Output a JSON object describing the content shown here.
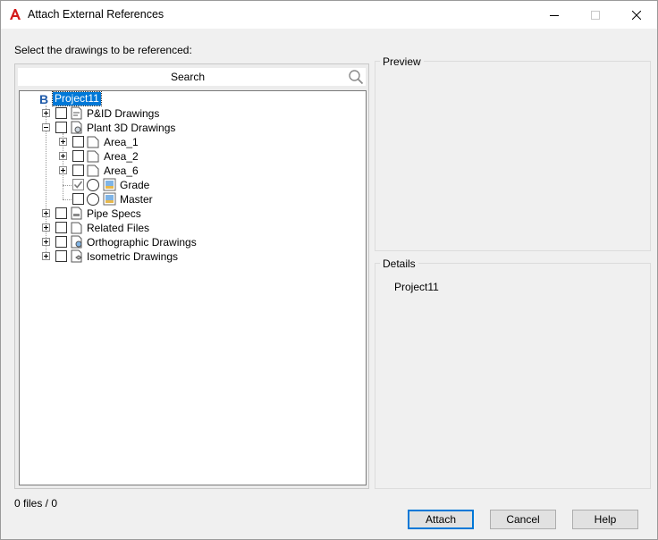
{
  "window": {
    "title": "Attach External References",
    "accent_color": "#0078d7",
    "app_icon": "autocad-a-icon"
  },
  "instruction": "Select the drawings to be referenced:",
  "search": {
    "label": "Search"
  },
  "tree": {
    "root": {
      "label": "Project11",
      "icon": "project-b-icon",
      "selected": true
    },
    "items": [
      {
        "label": "P&ID Drawings",
        "expanded": false,
        "checked": false,
        "icon": "pid-drawings-icon"
      },
      {
        "label": "Plant 3D Drawings",
        "expanded": true,
        "checked": false,
        "icon": "plant3d-drawings-icon"
      },
      {
        "label": "Area_1",
        "expanded": false,
        "checked": false,
        "icon": "folder-icon"
      },
      {
        "label": "Area_2",
        "expanded": false,
        "checked": false,
        "icon": "folder-icon"
      },
      {
        "label": "Area_6",
        "expanded": false,
        "checked": false,
        "icon": "folder-icon"
      },
      {
        "label": "Grade",
        "checked": true,
        "radio": false,
        "icon": "drawing-file-icon"
      },
      {
        "label": "Master",
        "checked": false,
        "radio": false,
        "icon": "drawing-file-icon"
      },
      {
        "label": "Pipe Specs",
        "expanded": false,
        "checked": false,
        "icon": "pipe-specs-icon"
      },
      {
        "label": "Related Files",
        "expanded": false,
        "checked": false,
        "icon": "related-files-icon"
      },
      {
        "label": "Orthographic Drawings",
        "expanded": false,
        "checked": false,
        "icon": "ortho-drawings-icon"
      },
      {
        "label": "Isometric Drawings",
        "expanded": false,
        "checked": false,
        "icon": "iso-drawings-icon"
      }
    ]
  },
  "preview": {
    "title": "Preview"
  },
  "details": {
    "title": "Details",
    "value": "Project11"
  },
  "status": "0 files / 0",
  "buttons": {
    "attach": "Attach",
    "cancel": "Cancel",
    "help": "Help"
  }
}
